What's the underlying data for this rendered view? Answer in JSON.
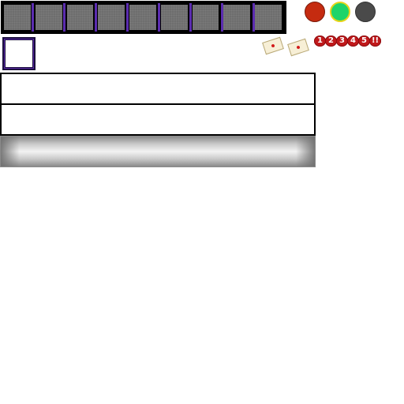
{
  "hotbar": {
    "slot_count": 9,
    "selected_slot": null,
    "colors": {
      "background": "#000000",
      "slot": "#6e6e6e",
      "separator": "#5b2cb0"
    }
  },
  "status_lights": [
    {
      "name": "red",
      "color": "#c52b10"
    },
    {
      "name": "green",
      "color": "#1ed46a"
    },
    {
      "name": "gray",
      "color": "#4a4a4a"
    }
  ],
  "letters": [
    {
      "icon": "envelope-icon"
    },
    {
      "icon": "envelope-icon"
    }
  ],
  "tokens": [
    "1",
    "2",
    "3",
    "4",
    "5",
    "!!"
  ],
  "panels": {
    "first_text": "",
    "second_text": "",
    "progress": null
  }
}
